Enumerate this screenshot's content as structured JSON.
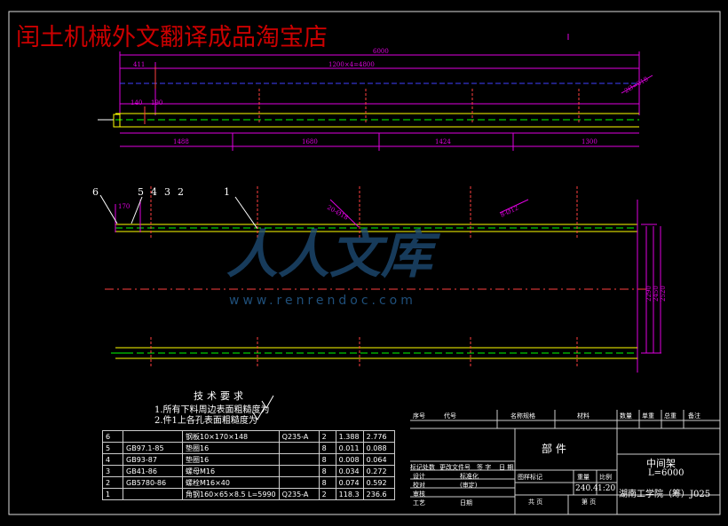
{
  "watermark": {
    "title": "闰土机械外文翻译成品淘宝店",
    "logo_text": "人人文库",
    "url": "www.renrendoc.com"
  },
  "dimensions": {
    "total": "6000",
    "left_offset": "411",
    "spacing": "1200×4=4800",
    "small_a": "140",
    "small_b": "190",
    "seg1": "1488",
    "seg2": "1680",
    "seg3": "1424",
    "seg4": "1300",
    "hole_note_top": "2Ø=018",
    "hole_note_mid1": "20-Ø18",
    "hole_note_mid2": "8-Ø12",
    "left_170": "170",
    "v1": "2290",
    "v2": "2450",
    "v3": "2520"
  },
  "balloons": [
    "6",
    "5",
    "4",
    "3",
    "2",
    "1"
  ],
  "tech": {
    "title": "技术要求",
    "line1": "1.所有下料周边表面粗糙度为",
    "line2": "2.件1上各孔表面粗糙度为"
  },
  "bom": [
    {
      "no": "6",
      "code": "",
      "name": "钢板10×170×148",
      "mat": "Q235-A",
      "qty": "2",
      "w1": "1.388",
      "w2": "2.776"
    },
    {
      "no": "5",
      "code": "GB97.1-85",
      "name": "垫圈16",
      "mat": "",
      "qty": "8",
      "w1": "0.011",
      "w2": "0.088"
    },
    {
      "no": "4",
      "code": "GB93-87",
      "name": "垫圈16",
      "mat": "",
      "qty": "8",
      "w1": "0.008",
      "w2": "0.064"
    },
    {
      "no": "3",
      "code": "GB41-86",
      "name": "螺母M16",
      "mat": "",
      "qty": "8",
      "w1": "0.034",
      "w2": "0.272"
    },
    {
      "no": "2",
      "code": "GB5780-86",
      "name": "螺栓M16×40",
      "mat": "",
      "qty": "8",
      "w1": "0.074",
      "w2": "0.592"
    },
    {
      "no": "1",
      "code": "",
      "name": "角钢160×65×8.5 L=5990",
      "mat": "Q235-A",
      "qty": "2",
      "w1": "118.3",
      "w2": "236.6"
    }
  ],
  "title_block": {
    "header": [
      "序号",
      "代号",
      "名称规格",
      "材料",
      "数量",
      "单重",
      "总重",
      "备注"
    ],
    "part_label": "部  件",
    "drawing_name": "中间架",
    "length": "L=6000",
    "school": "湖南工学院（筹）J025",
    "weight": "240.4",
    "scale": "1:20",
    "mark_label": "图样标记",
    "weight_label": "重量",
    "scale_label": "比例",
    "rows": [
      "标记处数",
      "更改文件号",
      "签  字",
      "日  期"
    ],
    "design": "设计",
    "check": "校对",
    "review": "审核",
    "process": "工艺",
    "standard": "标准化",
    "approve": "(审定)",
    "date": "日期",
    "sheets": "共    页",
    "sheet": "第    页"
  }
}
